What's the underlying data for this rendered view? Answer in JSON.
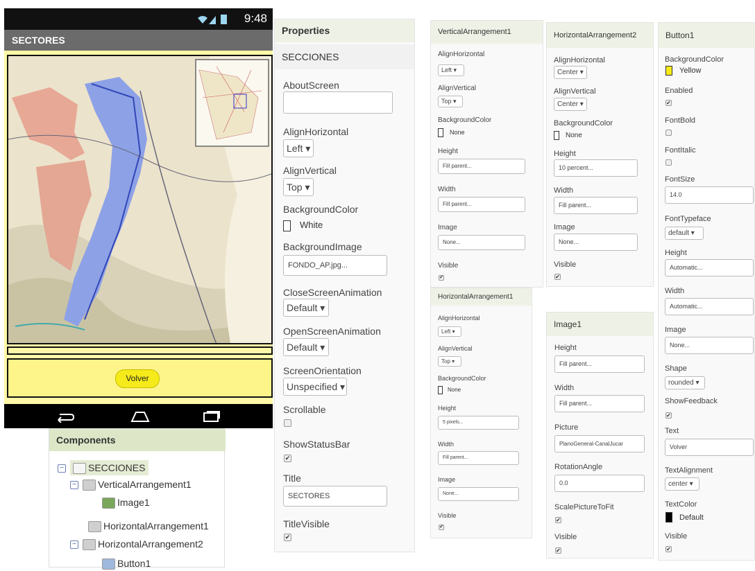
{
  "phone": {
    "time": "9:48",
    "title": "SECTORES",
    "volver_label": "Volver"
  },
  "components": {
    "header": "Components",
    "tree": [
      "SECCIONES",
      "VerticalArrangement1",
      "Image1",
      "HorizontalArrangement1",
      "HorizontalArrangement2",
      "Button1"
    ]
  },
  "properties": {
    "header": "Properties",
    "screen_name": "SECCIONES",
    "about_label": "AboutScreen",
    "about_value": "",
    "alignh_label": "AlignHorizontal",
    "alignh_value": "Left",
    "alignv_label": "AlignVertical",
    "alignv_value": "Top",
    "bg_label": "BackgroundColor",
    "bg_value": "White",
    "bgimg_label": "BackgroundImage",
    "bgimg_value": "FONDO_AP.jpg...",
    "close_label": "CloseScreenAnimation",
    "close_value": "Default",
    "open_label": "OpenScreenAnimation",
    "open_value": "Default",
    "orient_label": "ScreenOrientation",
    "orient_value": "Unspecified",
    "scroll_label": "Scrollable",
    "status_label": "ShowStatusBar",
    "title_label": "Title",
    "title_value": "SECTORES",
    "titlevis_label": "TitleVisible"
  },
  "va1": {
    "header": "VerticalArrangement1",
    "alignh_label": "AlignHorizontal",
    "alignh_value": "Left",
    "alignv_label": "AlignVertical",
    "alignv_value": "Top",
    "bg_label": "BackgroundColor",
    "bg_value": "None",
    "height_label": "Height",
    "height_value": "Fill parent...",
    "width_label": "Width",
    "width_value": "Fill parent...",
    "image_label": "Image",
    "image_value": "None...",
    "visible_label": "Visible"
  },
  "ha1": {
    "header": "HorizontalArrangement1",
    "alignh_label": "AlignHorizontal",
    "alignh_value": "Left",
    "alignv_label": "AlignVertical",
    "alignv_value": "Top",
    "bg_label": "BackgroundColor",
    "bg_value": "None",
    "height_label": "Height",
    "height_value": "5 pixels...",
    "width_label": "Width",
    "width_value": "Fill parent...",
    "image_label": "Image",
    "image_value": "None...",
    "visible_label": "Visible"
  },
  "ha2": {
    "header": "HorizontalArrangement2",
    "alignh_label": "AlignHorizontal",
    "alignh_value": "Center",
    "alignv_label": "AlignVertical",
    "alignv_value": "Center",
    "bg_label": "BackgroundColor",
    "bg_value": "None",
    "height_label": "Height",
    "height_value": "10 percent...",
    "width_label": "Width",
    "width_value": "Fill parent...",
    "image_label": "Image",
    "image_value": "None...",
    "visible_label": "Visible"
  },
  "img1": {
    "header": "Image1",
    "height_label": "Height",
    "height_value": "Fill parent...",
    "width_label": "Width",
    "width_value": "Fill parent...",
    "picture_label": "Picture",
    "picture_value": "PlanoGeneral-CanalJucar",
    "rot_label": "RotationAngle",
    "rot_value": "0.0",
    "scale_label": "ScalePictureToFit",
    "visible_label": "Visible"
  },
  "btn1": {
    "header": "Button1",
    "bg_label": "BackgroundColor",
    "bg_value": "Yellow",
    "enabled_label": "Enabled",
    "bold_label": "FontBold",
    "italic_label": "FontItalic",
    "size_label": "FontSize",
    "size_value": "14.0",
    "typeface_label": "FontTypeface",
    "typeface_value": "default",
    "height_label": "Height",
    "height_value": "Automatic...",
    "width_label": "Width",
    "width_value": "Automatic...",
    "image_label": "Image",
    "image_value": "None...",
    "shape_label": "Shape",
    "shape_value": "rounded",
    "feedback_label": "ShowFeedback",
    "text_label": "Text",
    "text_value": "Volver",
    "align_label": "TextAlignment",
    "align_value": "center",
    "color_label": "TextColor",
    "color_value": "Default",
    "visible_label": "Visible"
  },
  "check_glyph": "✔",
  "colors": {
    "yellow": "#f6eb1a",
    "screen_bg": "#fff8a8",
    "panel_header": "#eef2e6"
  }
}
